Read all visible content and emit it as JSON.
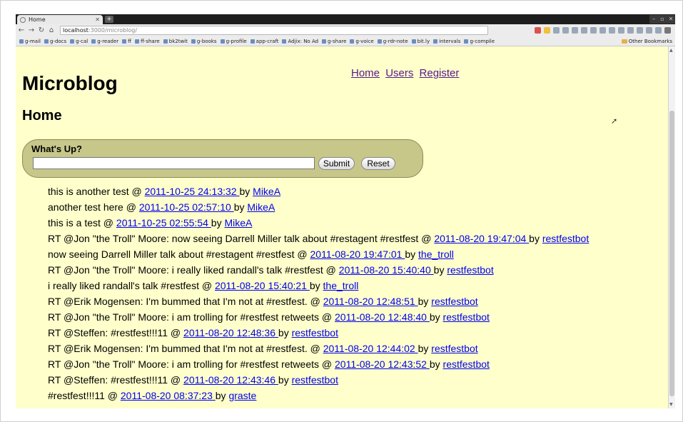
{
  "browser": {
    "tab_title": "Home",
    "url_host": "localhost",
    "url_path": ":3000/microblog/",
    "bookmarks": [
      "g-mail",
      "g-docs",
      "g-cal",
      "g-reader",
      "ff",
      "ff-share",
      "bk2twit",
      "g-books",
      "g-profile",
      "app-craft",
      "Adjix: No Ad",
      "g-share",
      "g-voice",
      "g-rdr-note",
      "bit.ly",
      "intervals",
      "g-compile"
    ],
    "other_bookmarks": "Other Bookmarks"
  },
  "site": {
    "title": "Microblog",
    "nav": [
      "Home",
      "Users",
      "Register"
    ]
  },
  "page": {
    "heading": "Home",
    "form": {
      "label": "What's Up?",
      "input_value": "",
      "submit_label": "Submit",
      "reset_label": "Reset"
    }
  },
  "feed": [
    {
      "text": "this is another test @ ",
      "date": "2011-10-25 24:13:32 ",
      "by": "by ",
      "user": "MikeA"
    },
    {
      "text": "another test here @ ",
      "date": "2011-10-25 02:57:10 ",
      "by": "by ",
      "user": "MikeA"
    },
    {
      "text": "this is a test @ ",
      "date": "2011-10-25 02:55:54 ",
      "by": "by ",
      "user": "MikeA"
    },
    {
      "text": "RT @Jon \"the Troll\" Moore: now seeing Darrell Miller talk about #restagent #restfest @ ",
      "date": "2011-08-20 19:47:04 ",
      "by": "by ",
      "user": "restfestbot"
    },
    {
      "text": "now seeing Darrell Miller talk about #restagent #restfest @ ",
      "date": "2011-08-20 19:47:01 ",
      "by": "by ",
      "user": "the_troll"
    },
    {
      "text": "RT @Jon \"the Troll\" Moore: i really liked randall's talk #restfest @ ",
      "date": "2011-08-20 15:40:40 ",
      "by": "by ",
      "user": "restfestbot"
    },
    {
      "text": "i really liked randall's talk #restfest @ ",
      "date": "2011-08-20 15:40:21 ",
      "by": "by ",
      "user": "the_troll"
    },
    {
      "text": "RT @Erik Mogensen: I'm bummed that I'm not at #restfest. @ ",
      "date": "2011-08-20 12:48:51 ",
      "by": "by ",
      "user": "restfestbot"
    },
    {
      "text": "RT @Jon \"the Troll\" Moore: i am trolling for #restfest retweets @ ",
      "date": "2011-08-20 12:48:40 ",
      "by": "by ",
      "user": "restfestbot"
    },
    {
      "text": "RT @Steffen: #restfest!!!11 @ ",
      "date": "2011-08-20 12:48:36 ",
      "by": "by ",
      "user": "restfestbot"
    },
    {
      "text": "RT @Erik Mogensen: I'm bummed that I'm not at #restfest. @ ",
      "date": "2011-08-20 12:44:02 ",
      "by": "by ",
      "user": "restfestbot"
    },
    {
      "text": "RT @Jon \"the Troll\" Moore: i am trolling for #restfest retweets @ ",
      "date": "2011-08-20 12:43:52 ",
      "by": "by ",
      "user": "restfestbot"
    },
    {
      "text": "RT @Steffen: #restfest!!!11 @ ",
      "date": "2011-08-20 12:43:46 ",
      "by": "by ",
      "user": "restfestbot"
    },
    {
      "text": "#restfest!!!11 @ ",
      "date": "2011-08-20 08:37:23 ",
      "by": "by ",
      "user": "graste"
    }
  ]
}
